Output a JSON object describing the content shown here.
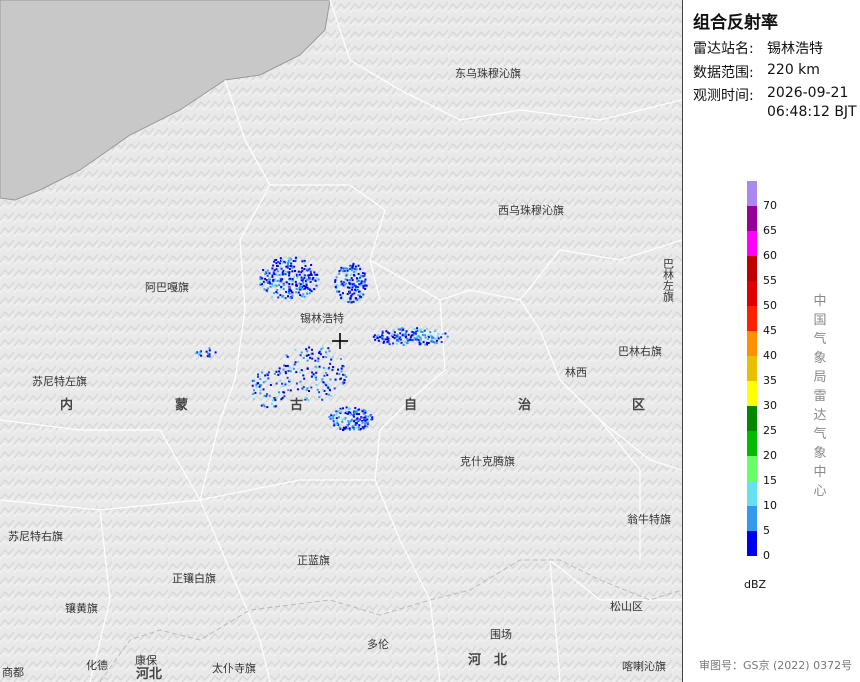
{
  "panel": {
    "title": "组合反射率",
    "station_label": "雷达站名:",
    "station_value": "锡林浩特",
    "range_label": "数据范围:",
    "range_value": "220 km",
    "time_label": "观测时间:",
    "time_date": "2026-09-21",
    "time_clock": "06:48:12 BJT",
    "unit": "dBZ",
    "agency": "中国气象局雷达气象中心",
    "footer": "审图号：GS京 (2022) 0372号",
    "legend": [
      {
        "label": "70",
        "color": "#aa88ee"
      },
      {
        "label": "65",
        "color": "#990099"
      },
      {
        "label": "60",
        "color": "#ff00ff"
      },
      {
        "label": "55",
        "color": "#c00000"
      },
      {
        "label": "50",
        "color": "#e00000"
      },
      {
        "label": "45",
        "color": "#ff2000"
      },
      {
        "label": "40",
        "color": "#ff9000"
      },
      {
        "label": "35",
        "color": "#e8c000"
      },
      {
        "label": "30",
        "color": "#ffff00"
      },
      {
        "label": "25",
        "color": "#008800"
      },
      {
        "label": "20",
        "color": "#00bb00"
      },
      {
        "label": "15",
        "color": "#66ff66"
      },
      {
        "label": "10",
        "color": "#66e0f0"
      },
      {
        "label": "5",
        "color": "#3399ee"
      },
      {
        "label": "0",
        "color": "#0000ee"
      }
    ]
  },
  "map": {
    "labels": {
      "dongwu": "东乌珠穆沁旗",
      "xiwu": "西乌珠穆沁旗",
      "abaga": "阿巴嘎旗",
      "xilin": "锡林浩特",
      "sunite_left": "苏尼特左旗",
      "sunite_right": "苏尼特右旗",
      "linxi": "林西",
      "balin_right": "巴林右旗",
      "balin_left": "巴林左旗",
      "keshi": "克什克腾旗",
      "wengniute": "翁牛特旗",
      "zhenglan": "正蓝旗",
      "zhengxiangbai": "正镶白旗",
      "xianghuang": "镶黄旗",
      "songshan": "松山区",
      "duolun": "多伦",
      "weichang": "围场",
      "kangbao": "康保",
      "huade": "化德",
      "shangdu": "商都",
      "taipusi": "太仆寺旗",
      "kalaqin": "喀喇沁旗"
    },
    "provinces": {
      "nei": "内",
      "meng": "蒙",
      "gu": "古",
      "zi": "自",
      "zhi": "治",
      "qu": "区",
      "hebei_a": "河北",
      "hebei_b": "河　北",
      "hebei_c": "河北"
    }
  }
}
